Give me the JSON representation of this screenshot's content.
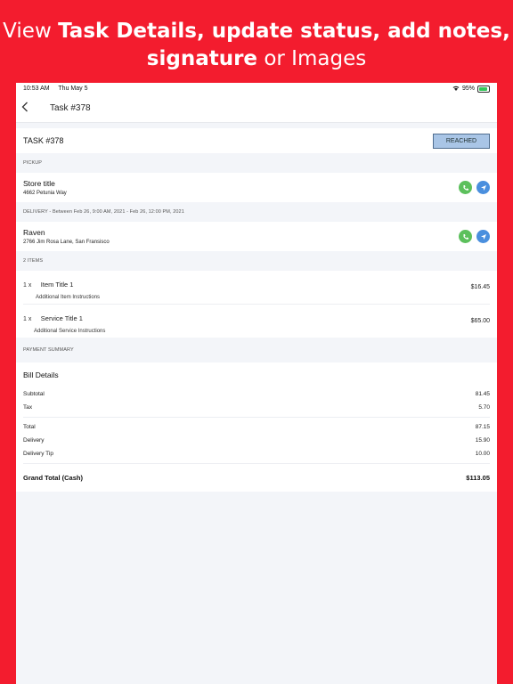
{
  "promo": {
    "line1_pre": "View ",
    "line1_bold": "Task Details, update status, add notes,",
    "line2_bold": "signature",
    "line2_post": " or Images"
  },
  "status_bar": {
    "time": "10:53 AM",
    "date": "Thu May 5",
    "battery_percent": "95%"
  },
  "nav": {
    "back_icon": "chevron-left-icon",
    "title": "Task #378"
  },
  "task": {
    "label": "TASK #378",
    "status_button": "REACHED"
  },
  "pickup": {
    "section_label": "PICKUP",
    "name": "Store title",
    "address": "4662  Petunia Way"
  },
  "delivery": {
    "section_label": "DELIVERY - Between Feb 26, 9:00 AM, 2021 - Feb 26, 12:00 PM, 2021",
    "name": "Raven",
    "address": "2766  Jim Rosa Lane, San Fransisco"
  },
  "items": {
    "section_label": "2 ITEMS",
    "list": [
      {
        "qty": "1 x",
        "title": "Item Title 1",
        "instructions": "Additional Item Instructions",
        "price": "$16.45"
      },
      {
        "qty": "1 x",
        "title": "Service Title 1",
        "instructions": "Additional Service Instructions",
        "price": "$65.00"
      }
    ]
  },
  "payment": {
    "section_label": "PAYMENT SUMMARY",
    "bill_title": "Bill Details",
    "subtotal_label": "Subtotal",
    "subtotal": "81.45",
    "tax_label": "Tax",
    "tax": "5.70",
    "total_label": "Total",
    "total": "87.15",
    "delivery_label": "Delivery",
    "delivery": "15.90",
    "tip_label": "Delivery Tip",
    "tip": "10.00",
    "grand_label": "Grand Total (Cash)",
    "grand": "$113.05"
  },
  "colors": {
    "brand_red": "#f31c2e",
    "call_green": "#5cc05c",
    "navigate_blue": "#4a8fde",
    "status_button": "#a9c5e6"
  }
}
